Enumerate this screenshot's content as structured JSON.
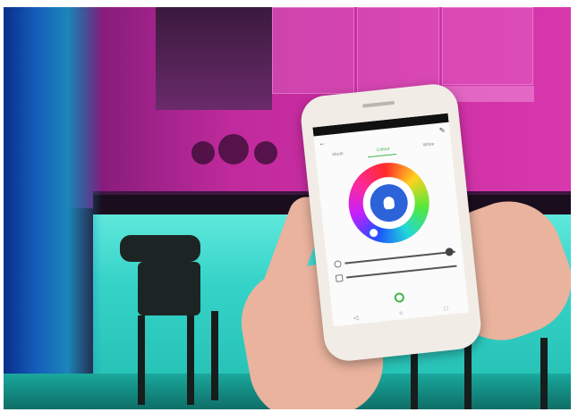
{
  "phone_app": {
    "status_time": "",
    "tabs": [
      {
        "label": "Mode"
      },
      {
        "label": "Colour"
      },
      {
        "label": "White"
      }
    ],
    "bottom": {
      "left_label": "",
      "right_label": ""
    },
    "colors": {
      "accent": "#3fb54b",
      "center": "#2d63d9"
    },
    "icons": {
      "back": "back-arrow-icon",
      "edit": "pencil-icon",
      "bulb": "lightbulb-icon",
      "power": "power-icon"
    }
  }
}
